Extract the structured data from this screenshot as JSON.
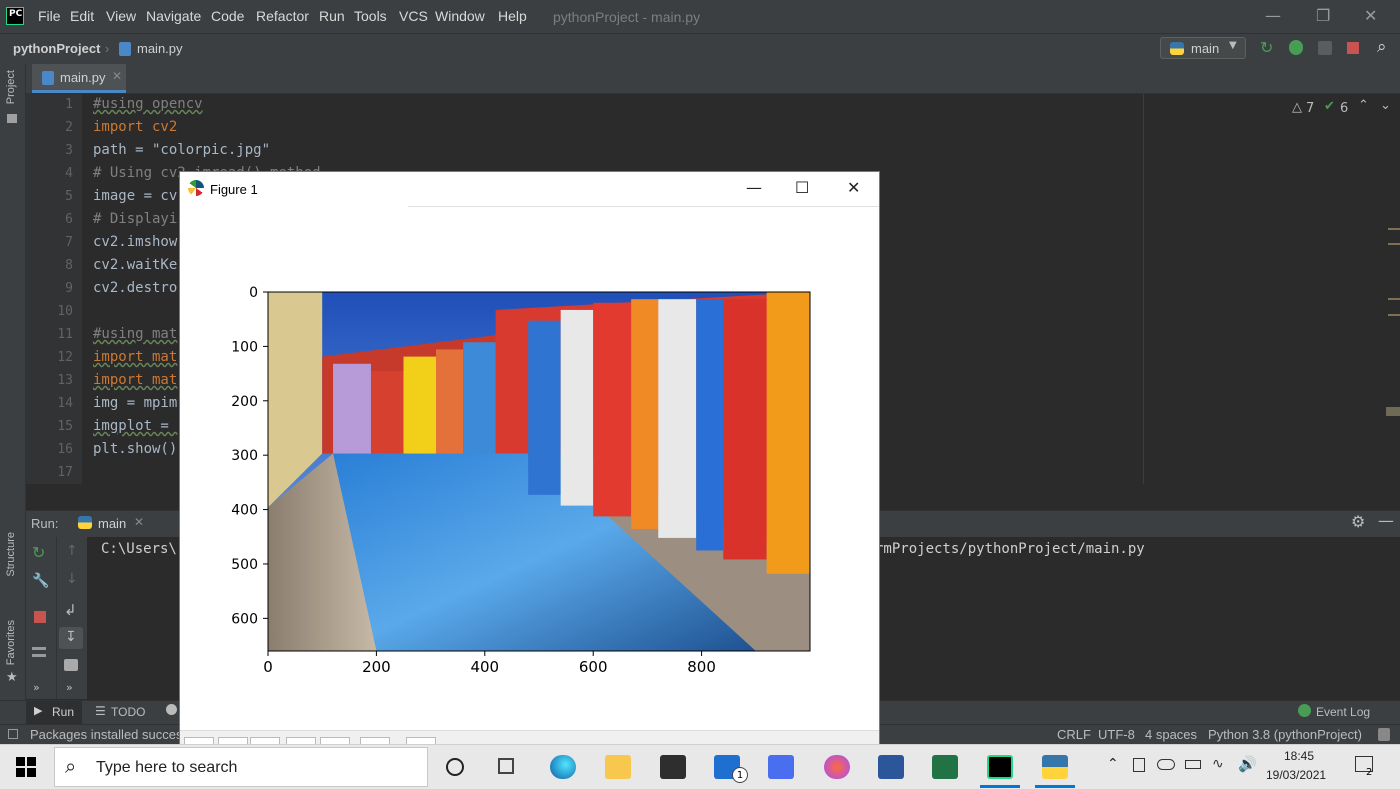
{
  "titlebar": {
    "menu": [
      "File",
      "Edit",
      "View",
      "Navigate",
      "Code",
      "Refactor",
      "Run",
      "Tools",
      "VCS",
      "Window",
      "Help"
    ],
    "window_title": "pythonProject - main.py"
  },
  "navbar": {
    "project": "pythonProject",
    "file": "main.py",
    "run_config": "main"
  },
  "left_stripe": {
    "project_label": "Project",
    "structure_label": "Structure",
    "favorites_label": "Favorites"
  },
  "editor": {
    "tab": "main.py",
    "inspections": {
      "warnings": "7",
      "ok": "6"
    },
    "line_numbers": [
      "1",
      "2",
      "3",
      "4",
      "5",
      "6",
      "7",
      "8",
      "9",
      "10",
      "11",
      "12",
      "13",
      "14",
      "15",
      "16",
      "17"
    ],
    "lines": [
      "#using opencv",
      "import cv2",
      "path = \"colorpic.jpg\"",
      "# Using cv2.imread() method",
      "image = cv",
      "# Displayi",
      "cv2.imshow",
      "cv2.waitKe",
      "cv2.destro",
      "",
      "#using mat",
      "import mat",
      "import mat",
      "img = mpim",
      "imgplot = ",
      "plt.show()",
      ""
    ]
  },
  "run_panel": {
    "label": "Run:",
    "tab": "main",
    "console_left": "C:\\Users\\",
    "console_right": "rmProjects/pythonProject/main.py"
  },
  "bottom_tabs": {
    "run": "Run",
    "todo": "TODO",
    "event_log": "Event Log"
  },
  "statusbar": {
    "message": "Packages installed success",
    "line_sep": "CRLF",
    "encoding": "UTF-8",
    "indent": "4 spaces",
    "interpreter": "Python 3.8 (pythonProject)"
  },
  "figure": {
    "title": "Figure 1",
    "x_ticks": [
      "0",
      "200",
      "400",
      "600",
      "800"
    ],
    "y_ticks": [
      "0",
      "100",
      "200",
      "300",
      "400",
      "500",
      "600"
    ]
  },
  "chart_data": {
    "type": "image",
    "xlim": [
      0,
      1000
    ],
    "ylim": [
      660,
      0
    ],
    "x_ticks": [
      0,
      200,
      400,
      600,
      800
    ],
    "y_ticks": [
      0,
      100,
      200,
      300,
      400,
      500,
      600
    ]
  },
  "taskbar": {
    "search_placeholder": "Type here to search",
    "time": "18:45",
    "date": "19/03/2021",
    "mail_badge": "1",
    "notification_badge": "2"
  }
}
